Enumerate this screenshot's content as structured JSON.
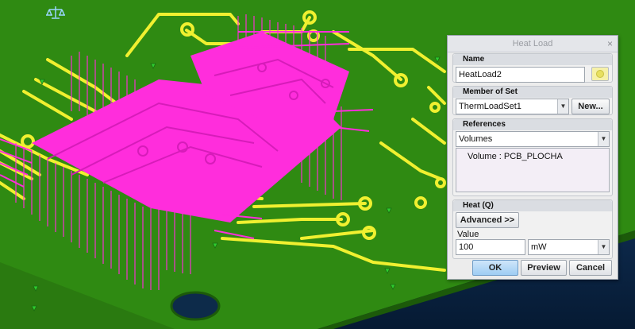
{
  "dialog": {
    "title": "Heat Load",
    "close_glyph": "×",
    "name_group": {
      "label": "Name",
      "value": "HeatLoad2",
      "color_swatch_icon": "color-swatch-icon"
    },
    "member_group": {
      "label": "Member of Set",
      "value": "ThermLoadSet1",
      "new_label": "New..."
    },
    "references_group": {
      "label": "References",
      "type_value": "Volumes",
      "items": [
        "Volume : PCB_PLOCHA"
      ]
    },
    "heat_group": {
      "label": "Heat (Q)",
      "advanced_label": "Advanced >>",
      "value_label": "Value",
      "value": "100",
      "unit": "mW"
    },
    "buttons": {
      "ok": "OK",
      "preview": "Preview",
      "cancel": "Cancel"
    }
  },
  "colors": {
    "board": "#2f8a12",
    "trace": "#f0f030",
    "component_pins": "#ff2ddc",
    "background": "#0b2a4a",
    "ok_button": "#9ecdf3"
  }
}
